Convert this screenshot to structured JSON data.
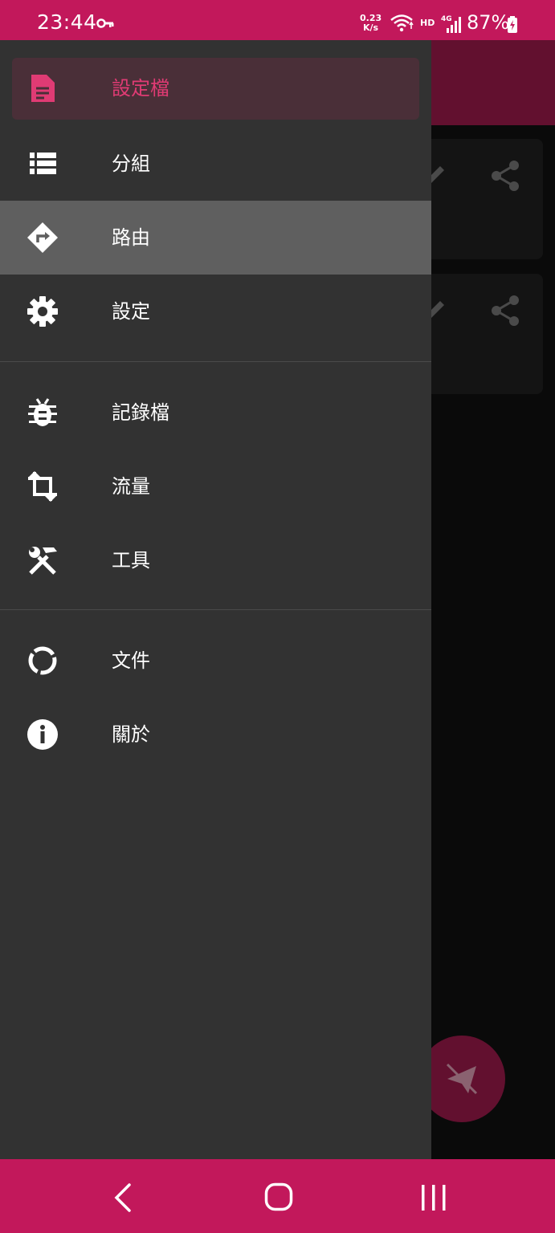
{
  "status_bar": {
    "time": "23:44",
    "net_speed_value": "0.23",
    "net_speed_unit": "K/s",
    "hd_label": "HD",
    "network_type": "4G",
    "battery_percent": "87%"
  },
  "drawer": {
    "primary_items": [
      {
        "label": "設定檔",
        "icon": "profile-file-icon",
        "selected": true
      },
      {
        "label": "分組",
        "icon": "group-list-icon"
      },
      {
        "label": "路由",
        "icon": "route-icon",
        "pressed": true
      },
      {
        "label": "設定",
        "icon": "settings-gear-icon"
      }
    ],
    "secondary_items": [
      {
        "label": "記錄檔",
        "icon": "log-bug-icon"
      },
      {
        "label": "流量",
        "icon": "traffic-crop-icon"
      },
      {
        "label": "工具",
        "icon": "tools-icon"
      }
    ],
    "tertiary_items": [
      {
        "label": "文件",
        "icon": "docs-circle-icon"
      },
      {
        "label": "關於",
        "icon": "about-info-icon"
      }
    ]
  },
  "colors": {
    "accent": "#c2185b",
    "selected_text": "#e03b74",
    "drawer_bg": "#323232"
  }
}
